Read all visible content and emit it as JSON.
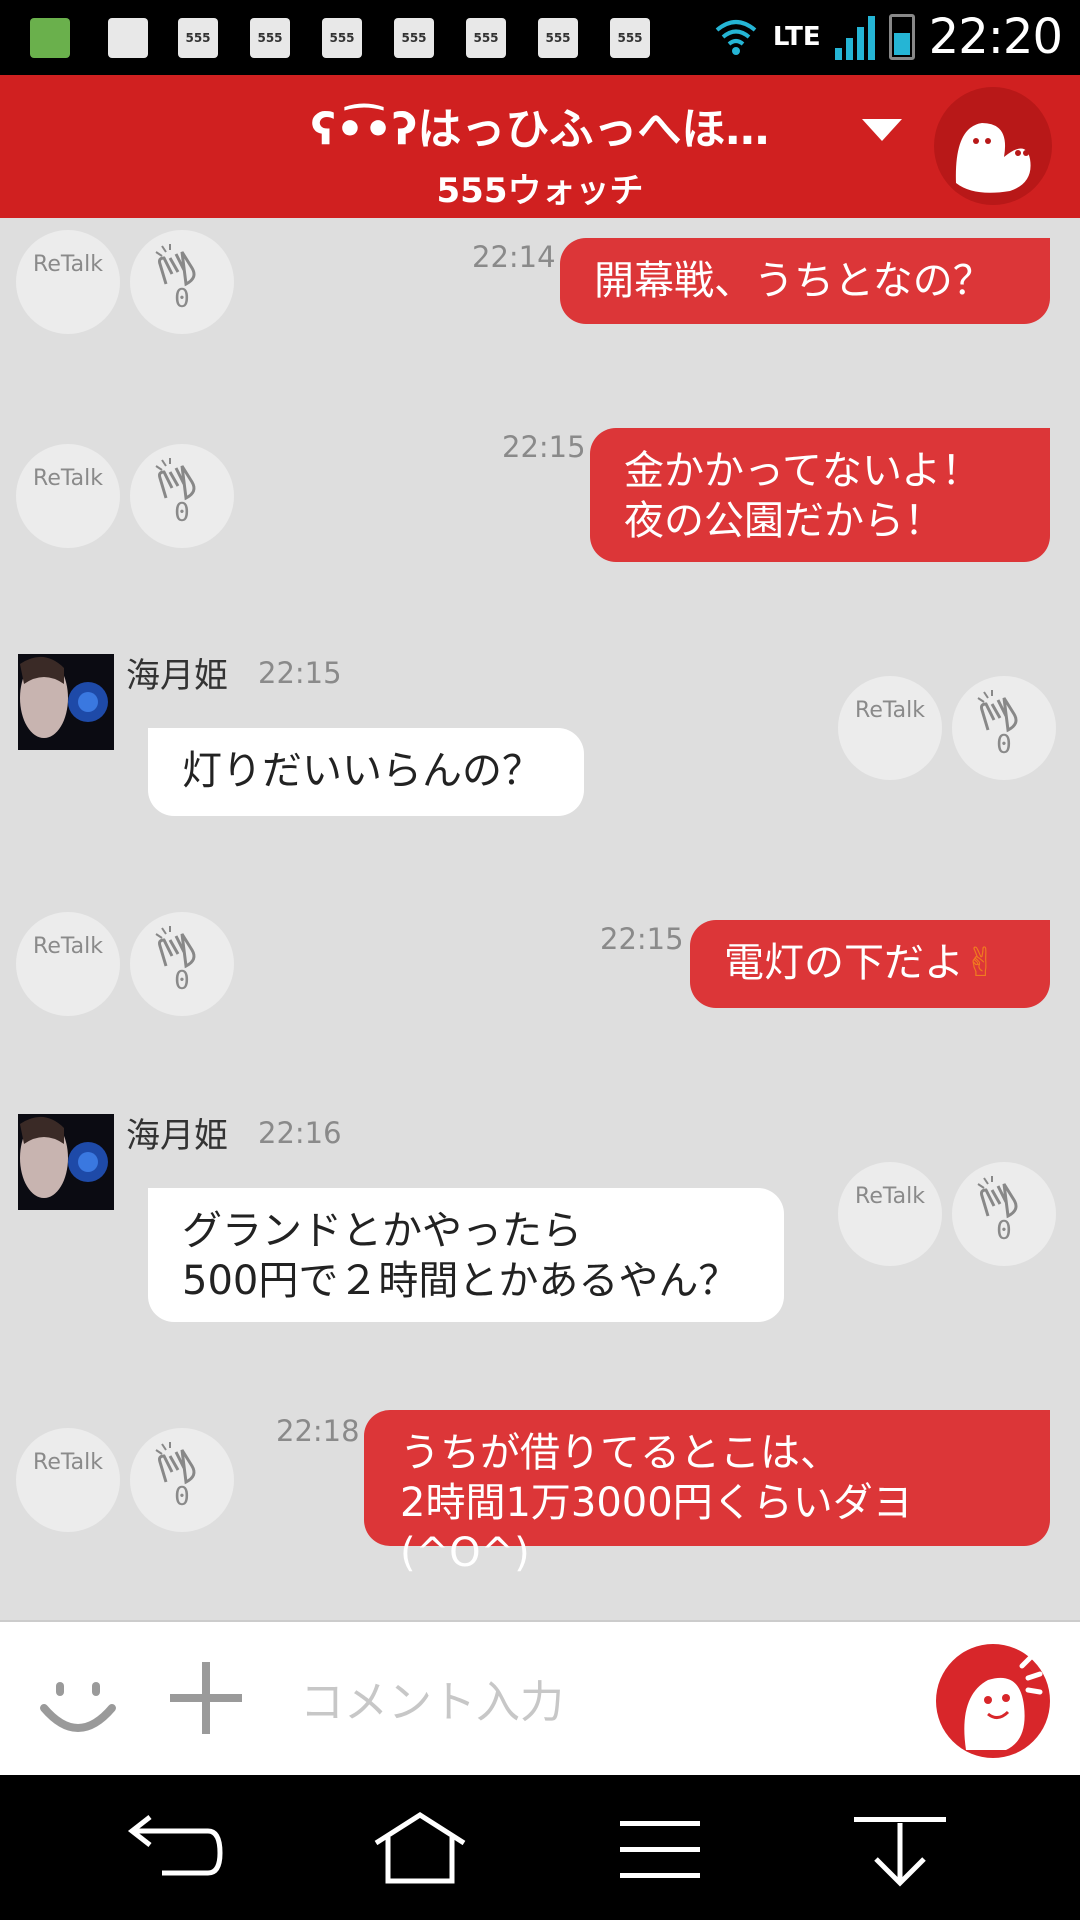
{
  "status_bar": {
    "time": "22:20",
    "network": "LTE",
    "notification_badges": [
      "555",
      "555",
      "555",
      "555",
      "555",
      "555",
      "555"
    ]
  },
  "header": {
    "title": "ʕ•͡•ʔはっひふっへほ…",
    "subtitle": "555ウォッチ"
  },
  "reaction": {
    "retalk_label": "ReTalk"
  },
  "messages": [
    {
      "side": "out",
      "time": "22:14",
      "lines": [
        "開幕戦、うちとなの？"
      ],
      "claps": "0"
    },
    {
      "side": "out",
      "time": "22:15",
      "lines": [
        "金かかってないよ！",
        "夜の公園だから！"
      ],
      "claps": "0"
    },
    {
      "side": "in",
      "sender": "海月姫",
      "time": "22:15",
      "lines": [
        "灯りだいいらんの？"
      ],
      "claps": "0"
    },
    {
      "side": "out",
      "time": "22:15",
      "lines": [
        "電灯の下だよ"
      ],
      "emoji": "✌",
      "claps": "0"
    },
    {
      "side": "in",
      "sender": "海月姫",
      "time": "22:16",
      "lines": [
        "グランドとかやったら",
        "500円で２時間とかあるやん？"
      ],
      "claps": "0"
    },
    {
      "side": "out",
      "time": "22:18",
      "lines": [
        "うちが借りてるとこは、",
        "2時間1万3000円くらいダヨ(^O^)"
      ],
      "claps": "0"
    }
  ],
  "input": {
    "placeholder": "コメント入力"
  },
  "colors": {
    "brand_red": "#d02020",
    "bubble_out": "#dc3638",
    "chat_background": "#dedede"
  }
}
